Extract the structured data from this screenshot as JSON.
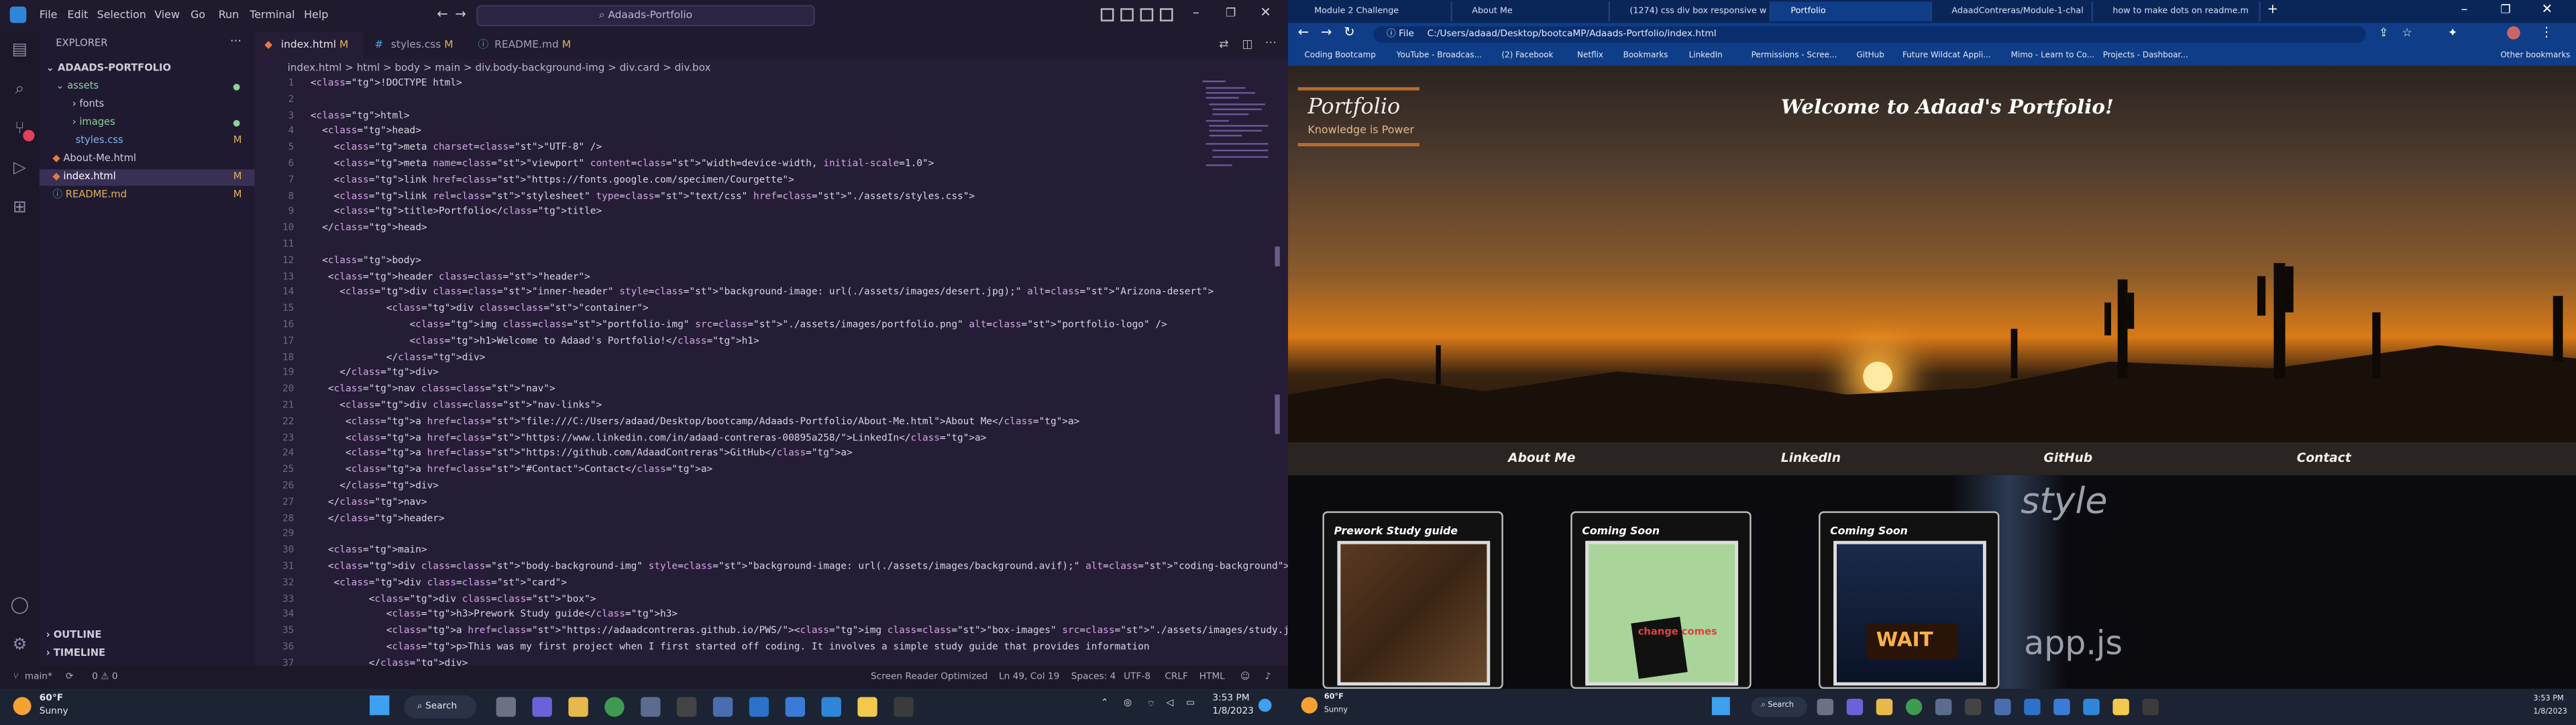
{
  "vscode": {
    "menu": [
      "File",
      "Edit",
      "Selection",
      "View",
      "Go",
      "Run",
      "Terminal",
      "Help"
    ],
    "search": "Adaads-Portfolio",
    "explorer": {
      "title": "EXPLORER",
      "folder": "ADAADS-PORTFOLIO",
      "items": [
        {
          "label": "assets",
          "badge": ""
        },
        {
          "label": "fonts",
          "badge": ""
        },
        {
          "label": "images",
          "badge": ""
        },
        {
          "label": "styles.css",
          "badge": "M"
        },
        {
          "label": "About-Me.html",
          "badge": ""
        },
        {
          "label": "index.html",
          "badge": "M"
        },
        {
          "label": "README.md",
          "badge": "M"
        }
      ],
      "outline": "OUTLINE",
      "timeline": "TIMELINE"
    },
    "tabs": [
      {
        "label": "index.html",
        "badge": "M"
      },
      {
        "label": "styles.css",
        "badge": "M"
      },
      {
        "label": "README.md",
        "badge": "M"
      }
    ],
    "breadcrumb": "index.html > html > body > main > div.body-background-img > div.card > div.box",
    "lines": [
      {
        "n": "1",
        "t": "<!DOCTYPE html>"
      },
      {
        "n": "2",
        "t": ""
      },
      {
        "n": "3",
        "t": "<html>"
      },
      {
        "n": "4",
        "t": "  <head>"
      },
      {
        "n": "5",
        "t": "    <meta charset=\"UTF-8\" />"
      },
      {
        "n": "6",
        "t": "    <meta name=\"viewport\" content=\"width=device-width, initial-scale=1.0\">"
      },
      {
        "n": "7",
        "t": "    <link href=\"https://fonts.google.com/specimen/Courgette\">"
      },
      {
        "n": "8",
        "t": "    <link rel=\"stylesheet\" type=\"text/css\" href=\"./assets/styles.css\">"
      },
      {
        "n": "9",
        "t": "    <title>Portfolio</title>"
      },
      {
        "n": "10",
        "t": "  </head>"
      },
      {
        "n": "11",
        "t": ""
      },
      {
        "n": "12",
        "t": "  <body>"
      },
      {
        "n": "13",
        "t": "   <header class=\"header\">"
      },
      {
        "n": "14",
        "t": "     <div class=\"inner-header\" style=\"background-image: url(./assets/images/desert.jpg);\" alt=\"Arizona-desert\">"
      },
      {
        "n": "15",
        "t": "             <div class=\"container\">"
      },
      {
        "n": "16",
        "t": "                 <img class=\"portfolio-img\" src=\"./assets/images/portfolio.png\" alt=\"portfolio-logo\" />"
      },
      {
        "n": "17",
        "t": "                 <h1>Welcome to Adaad's Portfolio!</h1>"
      },
      {
        "n": "18",
        "t": "             </div>"
      },
      {
        "n": "19",
        "t": "     </div>"
      },
      {
        "n": "20",
        "t": "   <nav class=\"nav\">"
      },
      {
        "n": "21",
        "t": "     <div class=\"nav-links\">"
      },
      {
        "n": "22",
        "t": "      <a href=\"file:///C:/Users/adaad/Desktop/bootcamp/Adaads-Portfolio/About-Me.html\">About Me</a>"
      },
      {
        "n": "23",
        "t": "      <a href=\"https://www.linkedin.com/in/adaad-contreras-00895a258/\">LinkedIn</a>"
      },
      {
        "n": "24",
        "t": "      <a href=\"https://github.com/AdaadContreras\">GitHub</a>"
      },
      {
        "n": "25",
        "t": "      <a href=\"#Contact\">Contact</a>"
      },
      {
        "n": "26",
        "t": "     </div>"
      },
      {
        "n": "27",
        "t": "   </nav>"
      },
      {
        "n": "28",
        "t": "   </header>"
      },
      {
        "n": "29",
        "t": ""
      },
      {
        "n": "30",
        "t": "   <main>"
      },
      {
        "n": "31",
        "t": "   <div class=\"body-background-img\" style=\"background-image: url(./assets/images/background.avif);\" alt=\"coding-background\">"
      },
      {
        "n": "32",
        "t": "    <div class=\"card\">"
      },
      {
        "n": "33",
        "t": "          <div class=\"box\">"
      },
      {
        "n": "34",
        "t": "             <h3>Prework Study guide</h3>"
      },
      {
        "n": "35",
        "t": "             <a href=\"https://adaadcontreras.github.io/PWS/\"><img class=\"box-images\" src=\"./assets/images/study.jpg\" alt=\"book\" /></a>"
      },
      {
        "n": "36",
        "t": "             <p>This was my first project when I first started off coding. It involves a simple study guide that provides information"
      },
      {
        "n": "37",
        "t": "          </div>"
      }
    ],
    "status": {
      "branch": "main*",
      "problems": "0 ⚠ 0",
      "screen_reader": "Screen Reader Optimized",
      "position": "Ln 49, Col 19",
      "spaces": "Spaces: 4",
      "encoding": "UTF-8",
      "eol": "CRLF",
      "language": "HTML"
    }
  },
  "browser": {
    "tabs": [
      "Module 2 Challenge",
      "About Me",
      "(1274) css div box responsive w",
      "Portfolio",
      "AdaadContreras/Module-1-chal",
      "how to make dots on readme.m"
    ],
    "active_tab": "Portfolio",
    "url_prefix": "File",
    "url": "C:/Users/adaad/Desktop/bootcaMP/Adaads-Portfolio/index.html",
    "bookmarks": [
      "Coding Bootcamp",
      "YouTube - Broadcas...",
      "(2) Facebook",
      "Netflix",
      "Bookmarks",
      "LinkedIn",
      "Permissions - Scree...",
      "GitHub",
      "Future Wildcat Appli...",
      "Mimo - Learn to Co...",
      "Projects - Dashboar..."
    ],
    "other_bookmarks": "Other bookmarks",
    "page": {
      "logo_title": "Portfolio",
      "logo_sub": "Knowledge is Power",
      "heading": "Welcome to Adaad's Portfolio!",
      "nav": [
        "About Me",
        "LinkedIn",
        "GitHub",
        "Contact"
      ],
      "cards": [
        "Prework Study guide",
        "Coming Soon",
        "Coming Soon"
      ],
      "card3_sign": "WAIT",
      "card2_text": "change comes"
    }
  },
  "taskbar": {
    "weather_temp": "60°F",
    "weather_desc": "Sunny",
    "search": "Search",
    "time": "3:53 PM",
    "date": "1/8/2023"
  }
}
